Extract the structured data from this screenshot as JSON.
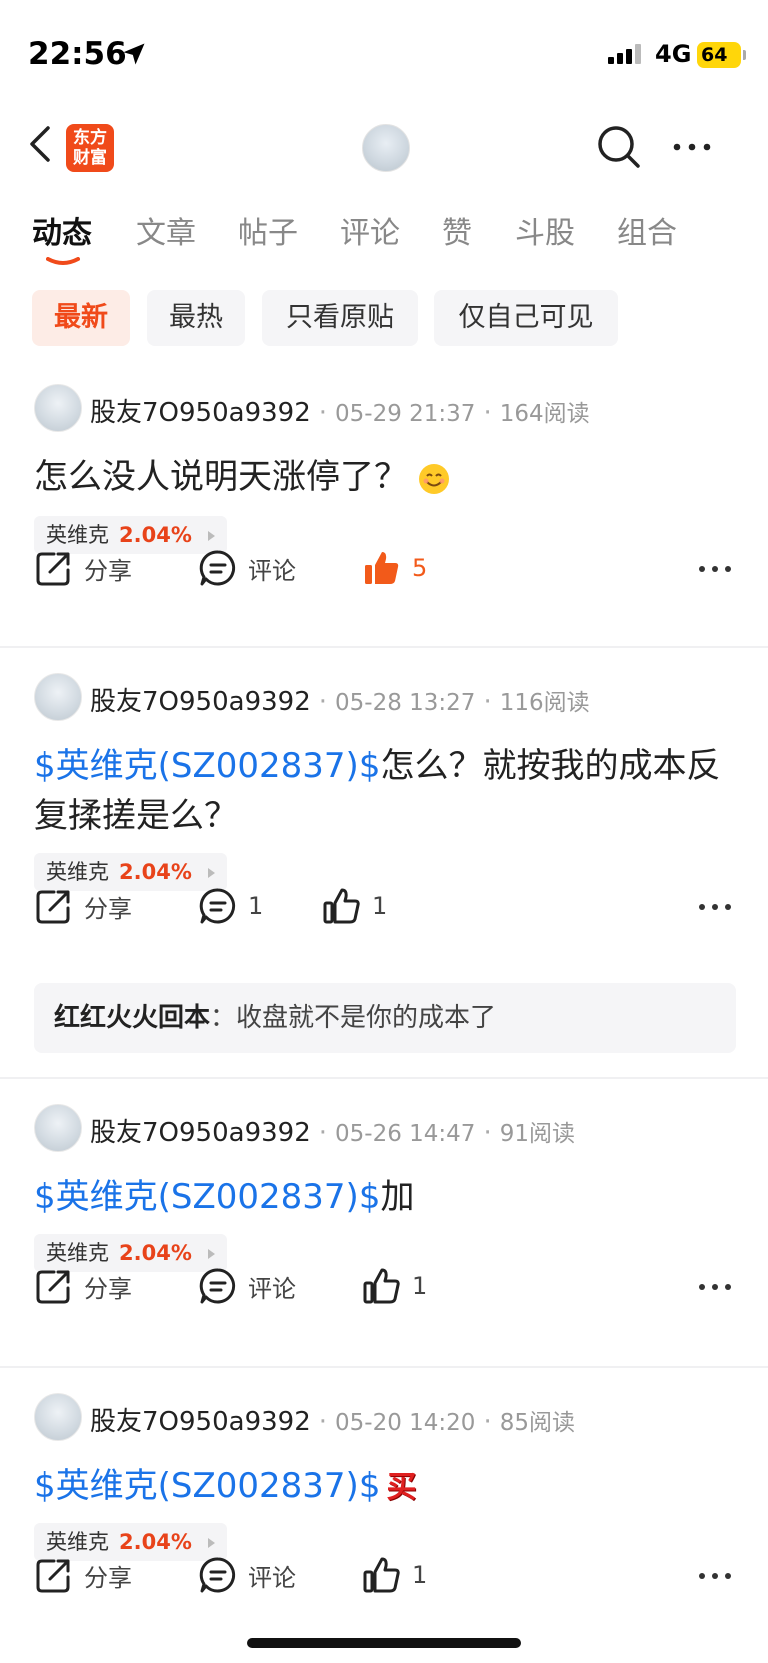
{
  "status_bar": {
    "time": "22:56",
    "network": "4G",
    "battery": "64"
  },
  "header": {
    "logo_line1": "东方",
    "logo_line2": "财富"
  },
  "tabs": [
    {
      "label": "动态",
      "active": true
    },
    {
      "label": "文章"
    },
    {
      "label": "帖子"
    },
    {
      "label": "评论"
    },
    {
      "label": "赞"
    },
    {
      "label": "斗股"
    },
    {
      "label": "组合"
    }
  ],
  "filters": [
    {
      "label": "最新",
      "active": true
    },
    {
      "label": "最热"
    },
    {
      "label": "只看原贴"
    },
    {
      "label": "仅自己可见"
    }
  ],
  "colors": {
    "accent": "#f04a1a",
    "link": "#1a73e8",
    "up": "#e8431a"
  },
  "posts": [
    {
      "user": "股友7O950a9392",
      "date": "05-29 21:37",
      "reads": "164阅读",
      "tag": "",
      "text": "怎么没人说明天涨停了？",
      "emoji": "smile-emoji",
      "stock": {
        "name": "英维克",
        "change": "2.04%"
      },
      "share": "分享",
      "comment": "评论",
      "likes": "5",
      "liked": true
    },
    {
      "user": "股友7O950a9392",
      "date": "05-28 13:27",
      "reads": "116阅读",
      "tag": "$英维克(SZ002837)$",
      "text": "怎么？就按我的成本反复揉搓是么？",
      "stock": {
        "name": "英维克",
        "change": "2.04%"
      },
      "share": "分享",
      "comment": "1",
      "likes": "1",
      "reply": {
        "user": "红红火火回本",
        "sep": "：",
        "text": "收盘就不是你的成本了"
      }
    },
    {
      "user": "股友7O950a9392",
      "date": "05-26 14:47",
      "reads": "91阅读",
      "tag": "$英维克(SZ002837)$",
      "text": "加",
      "stock": {
        "name": "英维克",
        "change": "2.04%"
      },
      "share": "分享",
      "comment": "评论",
      "likes": "1"
    },
    {
      "user": "股友7O950a9392",
      "date": "05-20 14:20",
      "reads": "85阅读",
      "tag": "$英维克(SZ002837)$",
      "text": "",
      "emoji_text": "买",
      "stock": {
        "name": "英维克",
        "change": "2.04%"
      },
      "share": "分享",
      "comment": "评论",
      "likes": "1"
    }
  ]
}
